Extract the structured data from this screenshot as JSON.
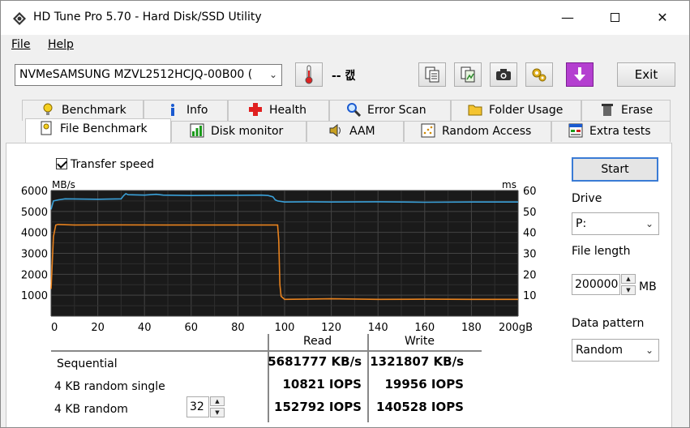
{
  "window": {
    "title": "HD Tune Pro 5.70 - Hard Disk/SSD Utility",
    "minimize": "—",
    "close": "✕"
  },
  "menu": {
    "file": "File",
    "help": "Help"
  },
  "toolbar": {
    "drive": "NVMeSAMSUNG MZVL2512HCJQ-00B00 (",
    "temperature": "-- 캢",
    "exit_label": "Exit"
  },
  "tabs_row1": [
    {
      "label": "Benchmark",
      "icon": "lightbulb-icon"
    },
    {
      "label": "Info",
      "icon": "info-icon"
    },
    {
      "label": "Health",
      "icon": "health-cross-icon"
    },
    {
      "label": "Error Scan",
      "icon": "magnifier-icon"
    },
    {
      "label": "Folder Usage",
      "icon": "folder-icon"
    },
    {
      "label": "Erase",
      "icon": "trash-icon"
    }
  ],
  "tabs_row2": [
    {
      "label": "File Benchmark",
      "icon": "file-benchmark-icon",
      "active": true
    },
    {
      "label": "Disk monitor",
      "icon": "disk-monitor-icon"
    },
    {
      "label": "AAM",
      "icon": "speaker-icon"
    },
    {
      "label": "Random Access",
      "icon": "random-access-icon"
    },
    {
      "label": "Extra tests",
      "icon": "extra-tests-icon"
    }
  ],
  "options": {
    "transfer_speed_label": "Transfer speed",
    "transfer_speed_checked": true,
    "start_label": "Start",
    "drive_label": "Drive",
    "drive_value": "P:",
    "file_length_label": "File length",
    "file_length_value": "200000",
    "file_length_unit": "MB",
    "data_pattern_label": "Data pattern",
    "data_pattern_value": "Random"
  },
  "results": {
    "read_header": "Read",
    "write_header": "Write",
    "rows": [
      {
        "label": "Sequential",
        "read": "5681777 KB/s",
        "write": "1321807 KB/s"
      },
      {
        "label": "4 KB random single",
        "read": "10821 IOPS",
        "write": "19956 IOPS"
      },
      {
        "label": "4 KB random",
        "read": "152792 IOPS",
        "write": "140528 IOPS",
        "queue_depth": "32"
      }
    ]
  },
  "chart_data": {
    "type": "line",
    "y_unit_left": "MB/s",
    "y_unit_right": "ms",
    "y_ticks_left": [
      "6000",
      "5000",
      "4000",
      "3000",
      "2000",
      "1000"
    ],
    "y_ticks_right": [
      "60",
      "50",
      "40",
      "30",
      "20",
      "10"
    ],
    "x_ticks": [
      "0",
      "20",
      "40",
      "60",
      "80",
      "100",
      "120",
      "140",
      "160",
      "180",
      "200gB"
    ],
    "xlim": [
      0,
      200
    ],
    "ylim_left": [
      0,
      6000
    ],
    "ylim_right": [
      0,
      60
    ],
    "grid": true,
    "series": [
      {
        "color": "#3aa0d8",
        "x": [
          0,
          1,
          3,
          6,
          20,
          30,
          31,
          32,
          33,
          40,
          45,
          48,
          60,
          80,
          90,
          93,
          95,
          96,
          97,
          100,
          110,
          120,
          140,
          160,
          180,
          200
        ],
        "y": [
          5100,
          5500,
          5550,
          5600,
          5580,
          5600,
          5750,
          5850,
          5800,
          5780,
          5820,
          5780,
          5760,
          5770,
          5780,
          5760,
          5700,
          5550,
          5500,
          5450,
          5460,
          5450,
          5460,
          5440,
          5450,
          5450
        ]
      },
      {
        "color": "#e8821e",
        "x": [
          0,
          1,
          2,
          3,
          10,
          30,
          50,
          70,
          90,
          97,
          97.5,
          98,
          98.5,
          100,
          120,
          140,
          160,
          180,
          200
        ],
        "y": [
          1300,
          3800,
          4350,
          4380,
          4350,
          4360,
          4350,
          4350,
          4350,
          4350,
          3600,
          1500,
          950,
          800,
          830,
          800,
          810,
          800,
          800
        ]
      }
    ]
  }
}
